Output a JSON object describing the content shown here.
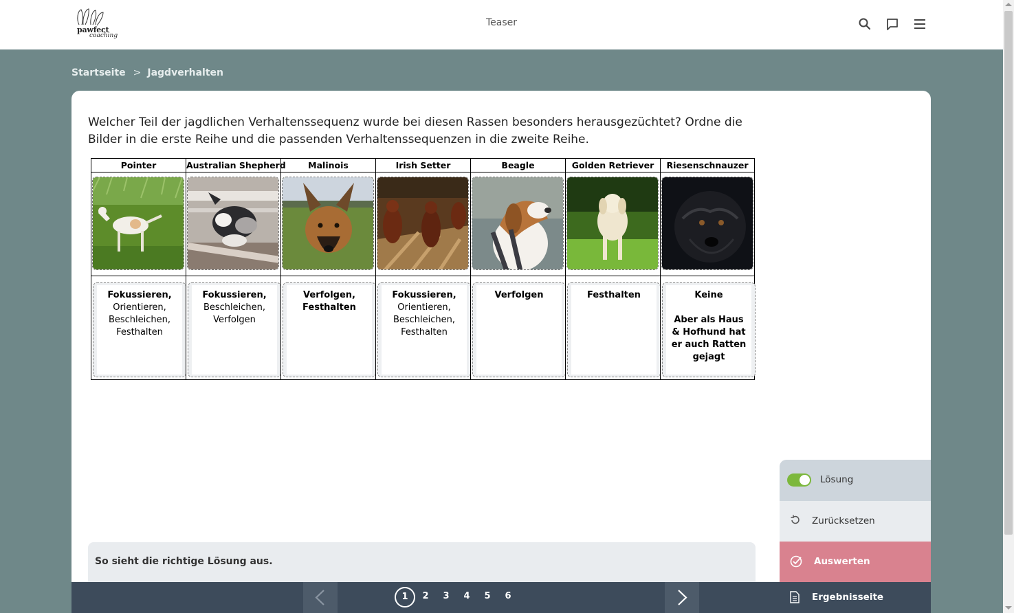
{
  "header": {
    "logo_line1": "pawfect",
    "logo_line2": "coaching",
    "title": "Teaser"
  },
  "breadcrumb": {
    "items": [
      "Startseite",
      "Jagdverhalten"
    ],
    "separator": ">"
  },
  "question": "Welcher Teil der jagdlichen Verhaltenssequenz wurde bei diesen Rassen besonders herausgezüchtet? Ordne die Bilder in die erste Reihe und die passenden Verhaltenssequenzen in die zweite Reihe.",
  "breeds": [
    {
      "name": "Pointer",
      "photo": "pointer-photo",
      "answer_html": "<b>Fokussieren,</b><br>Orientieren,<br>Beschleichen,<br>Festhalten"
    },
    {
      "name": "Australian Shepherd",
      "photo": "australian-shepherd-photo",
      "answer_html": "<b>Fokussieren,</b><br>Beschleichen,<br>Verfolgen"
    },
    {
      "name": "Malinois",
      "photo": "malinois-photo",
      "answer_html": "<b>Verfolgen,<br>Festhalten</b>"
    },
    {
      "name": "Irish Setter",
      "photo": "irish-setter-photo",
      "answer_html": "<b>Fokussieren,</b><br>Orientieren,<br>Beschleichen,<br>Festhalten"
    },
    {
      "name": "Beagle",
      "photo": "beagle-photo",
      "answer_html": "<b>Verfolgen</b>"
    },
    {
      "name": "Golden Retriever",
      "photo": "golden-retriever-photo",
      "answer_html": "<b>Festhalten</b>"
    },
    {
      "name": "Riesenschnauzer",
      "photo": "riesenschnauzer-photo",
      "answer_html": "<b>Keine</b><br><br><b>Aber als Haus &amp; Hofhund hat er auch Ratten gejagt</b>"
    }
  ],
  "solution_text": "So sieht die richtige Lösung aus.",
  "side_panel": {
    "solution_label": "Lösung",
    "solution_on": true,
    "reset_label": "Zurücksetzen",
    "evaluate_label": "Auswerten",
    "results_label": "Ergebnisseite"
  },
  "pagination": {
    "pages": [
      "1",
      "2",
      "3",
      "4",
      "5",
      "6"
    ],
    "current": "1"
  },
  "colors": {
    "background": "#6f8889",
    "evaluate": "#d9828f",
    "nav": "#3d4b5b",
    "toggle": "#7cb83c"
  }
}
